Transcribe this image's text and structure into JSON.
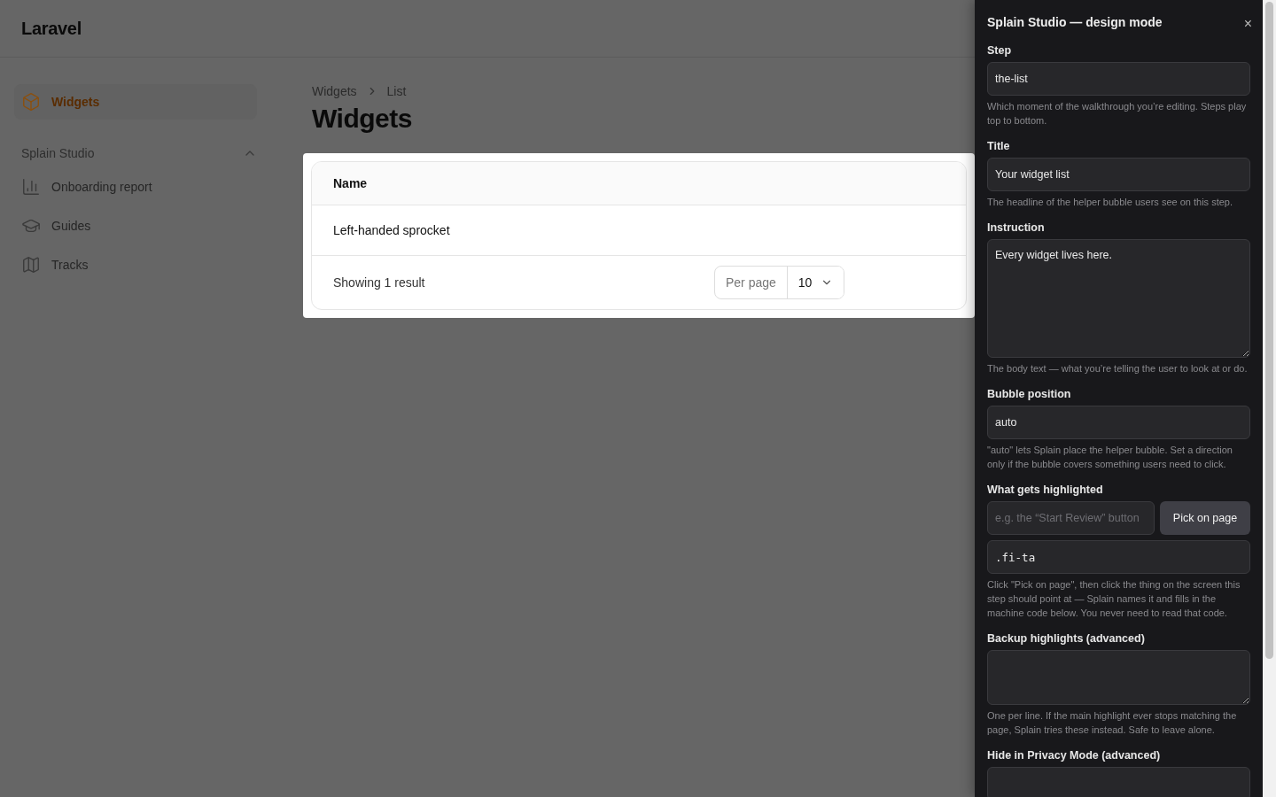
{
  "header": {
    "brand": "Laravel"
  },
  "sidebar": {
    "items": [
      {
        "label": "Widgets",
        "selected": true
      }
    ],
    "groups": [
      {
        "label": "Splain Studio",
        "expanded": true,
        "items": [
          {
            "label": "Onboarding report",
            "selected": false
          },
          {
            "label": "Guides",
            "selected": false
          },
          {
            "label": "Tracks",
            "selected": false
          }
        ]
      }
    ]
  },
  "breadcrumbs": [
    "Widgets",
    "List"
  ],
  "page_title": "Widgets",
  "table": {
    "columns": [
      "Name"
    ],
    "rows": [
      [
        "Left-handed sprocket"
      ]
    ],
    "summary": "Showing 1 result",
    "per_page": {
      "label": "Per page",
      "value": "10"
    }
  },
  "panel": {
    "title": "Splain Studio — design mode",
    "close": "×",
    "fields": [
      {
        "kind": "input",
        "label": "Step",
        "value": "the-list",
        "help": "Which moment of the walkthrough you’re editing. Steps play top to bottom."
      },
      {
        "kind": "input",
        "label": "Title",
        "value": "Your widget list",
        "help": "The headline of the helper bubble users see on this step."
      },
      {
        "kind": "textarea",
        "label": "Instruction",
        "value": "Every widget lives here.",
        "help": "The body text — what you’re telling the user to look at or do."
      },
      {
        "kind": "input",
        "label": "Bubble position",
        "value": "auto",
        "help": "\"auto\" lets Splain place the helper bubble. Set a direction only if the bubble covers something users need to click."
      },
      {
        "kind": "picker",
        "label": "What gets highlighted",
        "placeholder": "e.g. the “Start Review” button",
        "button": "Pick on page",
        "code": ".fi-ta",
        "help": "Click \"Pick on page\", then click the thing on the screen this step should point at — Splain names it and fills in the machine code below. You never need to read that code."
      },
      {
        "kind": "textarea",
        "label": "Backup highlights (advanced)",
        "help": "One per line. If the main highlight ever stops matching the page, Splain tries these instead. Safe to leave alone."
      },
      {
        "kind": "input",
        "label": "Hide in Privacy Mode (advanced)"
      }
    ]
  }
}
